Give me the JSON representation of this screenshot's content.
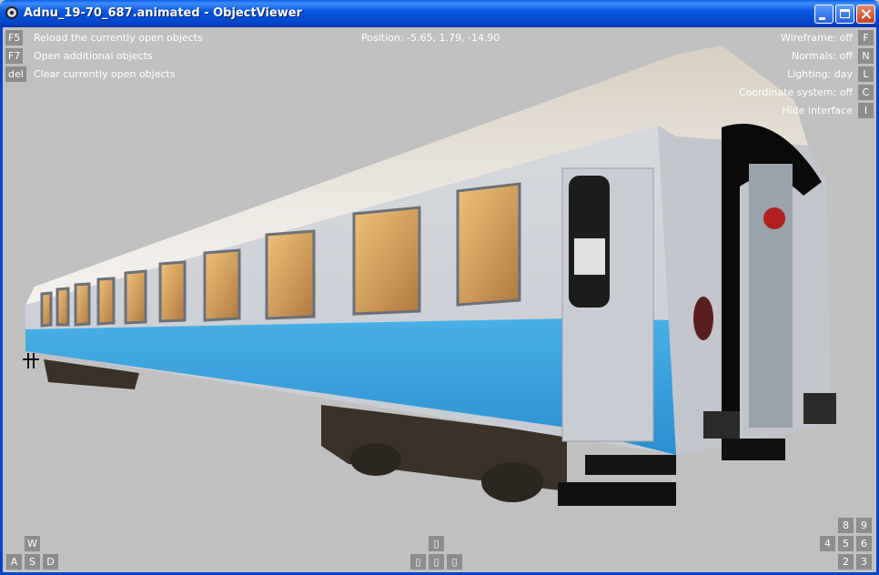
{
  "window": {
    "title": "Adnu_19-70_687.animated - ObjectViewer",
    "buttons": {
      "minimize": "minimize",
      "maximize": "maximize",
      "close": "close"
    }
  },
  "hud": {
    "left_commands": [
      {
        "key": "F5",
        "label": "Reload the currently open objects"
      },
      {
        "key": "F7",
        "label": "Open additional objects"
      },
      {
        "key": "del",
        "label": "Clear currently open objects"
      }
    ],
    "position": "Position: -5.65, 1.79, -14.90",
    "right_options": [
      {
        "label": "Wireframe: off",
        "key": "F"
      },
      {
        "label": "Normals: off",
        "key": "N"
      },
      {
        "label": "Lighting: day",
        "key": "L"
      },
      {
        "label": "Coordinate system: off",
        "key": "C"
      },
      {
        "label": "Hide interface",
        "key": "I"
      }
    ],
    "wasd": {
      "w": "W",
      "a": "A",
      "s": "S",
      "d": "D"
    },
    "arrows": {
      "up": "▯",
      "left": "▯",
      "mid": "▯",
      "right": "▯"
    },
    "numpad": {
      "n8": "8",
      "n9": "9",
      "n4": "4",
      "n5": "5",
      "n6": "6",
      "n2": "2",
      "n3": "3"
    }
  },
  "colors": {
    "background": "#c0c0c0",
    "titlebar": "#0a58e0",
    "key_bg": "#8c8c8c",
    "car_body": "#d8dce2",
    "car_stripe": "#3aa0dc",
    "car_roof": "#e6e2dc"
  }
}
